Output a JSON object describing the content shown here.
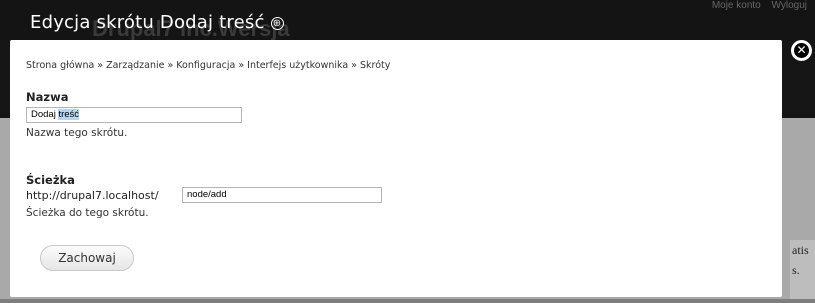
{
  "overlay": {
    "title": "Edycja skrótu Dodaj treść",
    "add_icon_glyph": "⊕",
    "close_glyph": "✕"
  },
  "background": {
    "site_name": "Drupal7 Inc.Wersja",
    "account_links": [
      "Moje konto",
      "Wyloguj"
    ],
    "sidebar_lines": [
      "atis",
      "s."
    ]
  },
  "breadcrumb": {
    "items": [
      "Strona główna",
      "Zarządzanie",
      "Konfiguracja",
      "Interfejs użytkownika",
      "Skróty"
    ],
    "separator": "»"
  },
  "form": {
    "name": {
      "label": "Nazwa",
      "value_plain": "Dodaj ",
      "value_selected": "treść",
      "description": "Nazwa tego skrótu."
    },
    "path": {
      "label": "Ścieżka",
      "prefix": "http://drupal7.localhost/",
      "value": "node/add",
      "description": "Ścieżka do tego skrótu."
    },
    "save_label": "Zachowaj"
  },
  "colors": {
    "overlay_background": "#1f1f1f",
    "dialog_background": "#ffffff",
    "selection_highlight": "#b5d5ff"
  }
}
